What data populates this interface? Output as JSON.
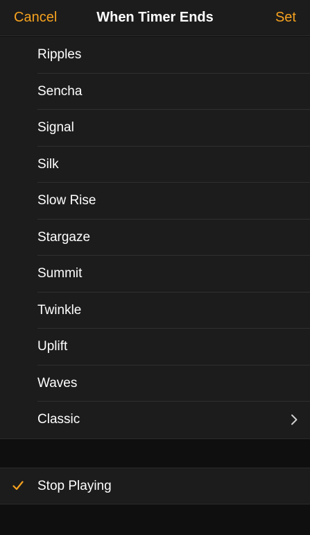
{
  "navbar": {
    "cancel_label": "Cancel",
    "title": "When Timer Ends",
    "set_label": "Set"
  },
  "tones": [
    {
      "label": "Ripples"
    },
    {
      "label": "Sencha"
    },
    {
      "label": "Signal"
    },
    {
      "label": "Silk"
    },
    {
      "label": "Slow Rise"
    },
    {
      "label": "Stargaze"
    },
    {
      "label": "Summit"
    },
    {
      "label": "Twinkle"
    },
    {
      "label": "Uplift"
    },
    {
      "label": "Waves"
    },
    {
      "label": "Classic",
      "icon": "chevron-right-icon"
    }
  ],
  "stop_option": {
    "label": "Stop Playing",
    "selected": true,
    "icon": "checkmark-icon"
  },
  "colors": {
    "accent": "#f6a21f",
    "background": "#0f0f0f",
    "cell": "#1c1c1c",
    "text": "#ffffff"
  }
}
